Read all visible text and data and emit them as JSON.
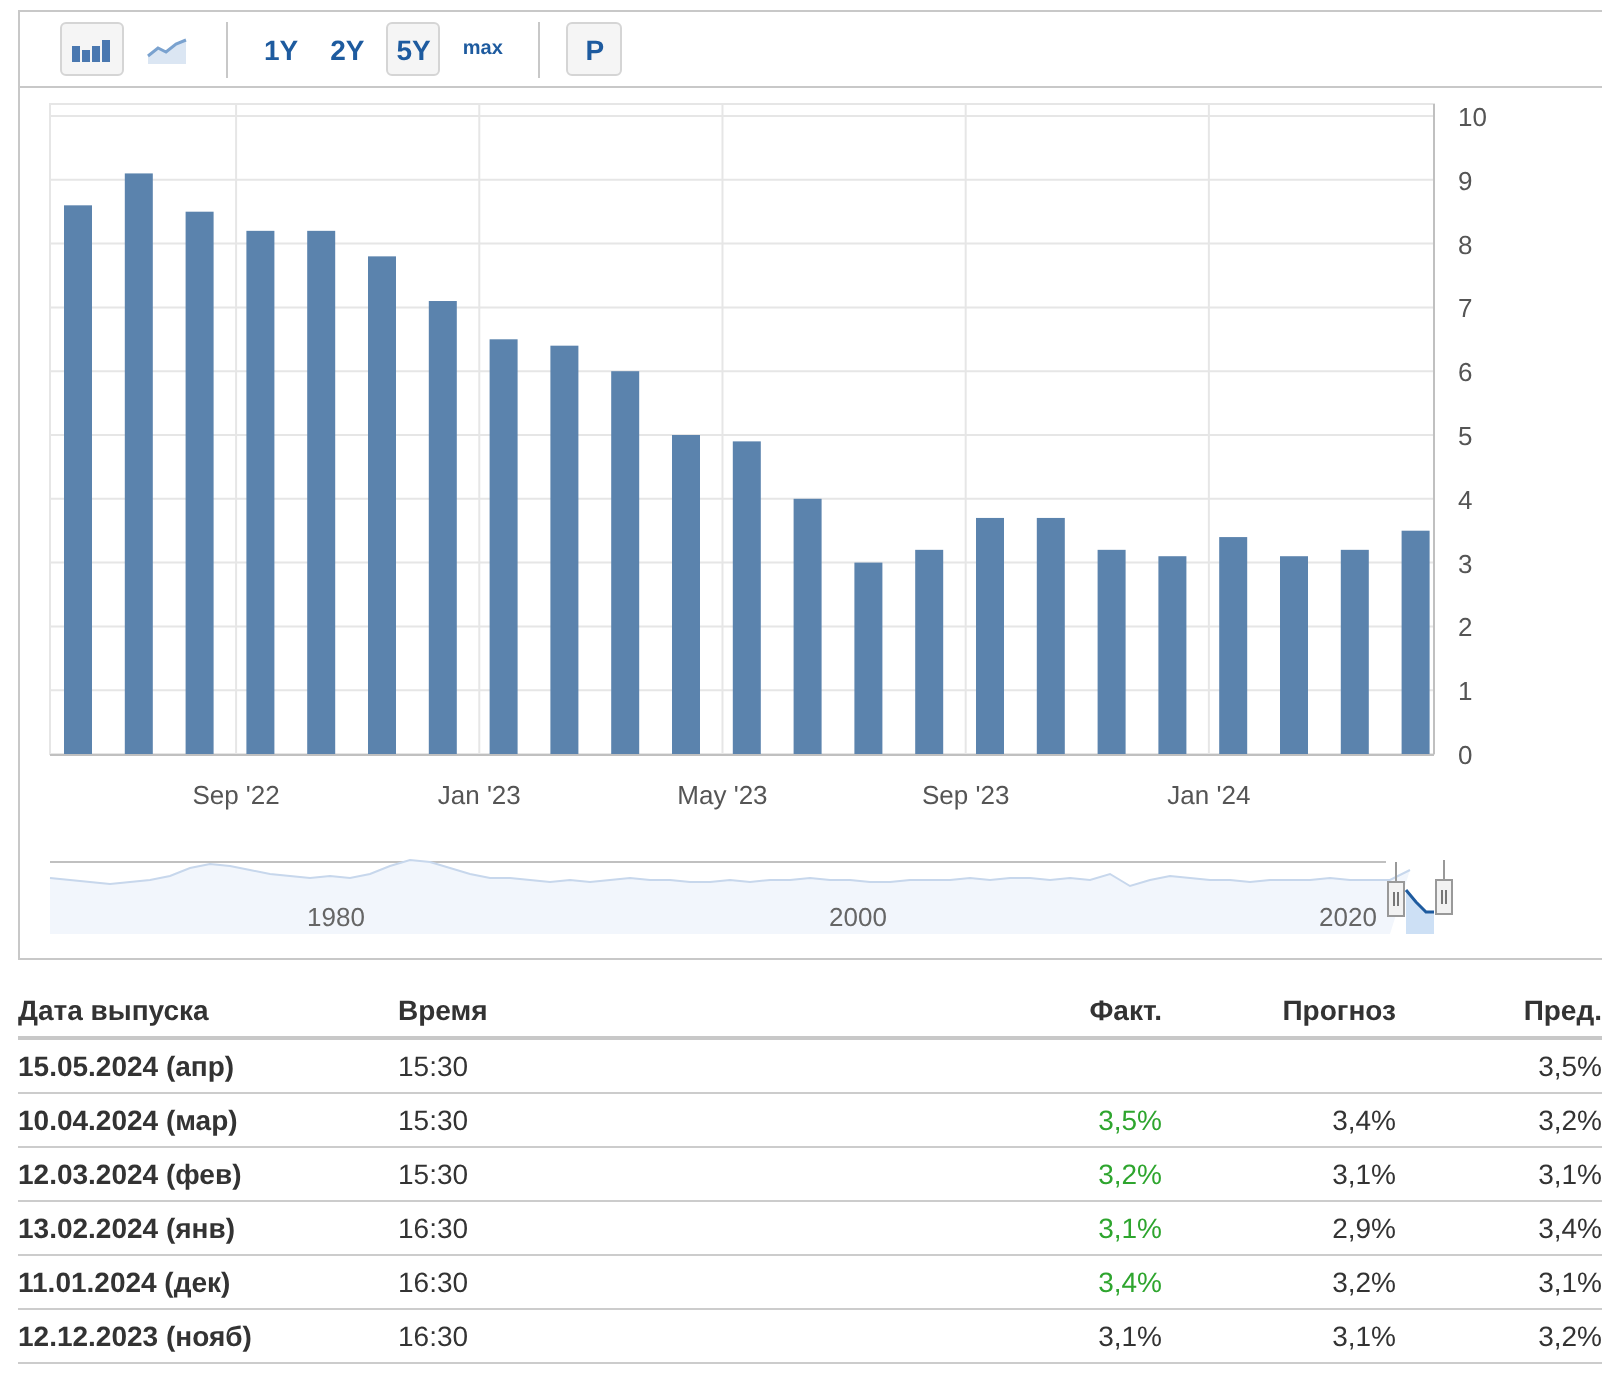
{
  "toolbar": {
    "chart_types": [
      {
        "kind": "bar",
        "selected": true
      },
      {
        "kind": "area",
        "selected": false
      }
    ],
    "ranges": [
      {
        "label": "1Y",
        "selected": false
      },
      {
        "label": "2Y",
        "selected": false
      },
      {
        "label": "5Y",
        "selected": true
      },
      {
        "label": "max",
        "selected": false
      }
    ],
    "extra_button": {
      "label": "P"
    }
  },
  "chart": {
    "chart_data": {
      "type": "bar",
      "categories": [
        null,
        null,
        null,
        "Sep '22",
        null,
        null,
        null,
        "Jan '23",
        null,
        null,
        null,
        "May '23",
        null,
        null,
        null,
        "Sep '23",
        null,
        null,
        null,
        "Jan '24",
        null,
        null,
        null
      ],
      "grid": true,
      "series": [
        {
          "color": "#5b83ad",
          "values": [
            8.6,
            9.1,
            8.5,
            8.2,
            8.2,
            7.8,
            7.1,
            6.5,
            6.4,
            6.0,
            5.0,
            4.9,
            4.0,
            3.0,
            3.2,
            3.7,
            3.7,
            3.2,
            3.1,
            3.4,
            3.1,
            3.2,
            3.5
          ]
        }
      ],
      "ylim": [
        0,
        10
      ],
      "yticks": [
        0,
        1,
        2,
        3,
        4,
        5,
        6,
        7,
        8,
        9,
        10
      ]
    },
    "navigator": {
      "labels": [
        "1980",
        "2000",
        "2020"
      ]
    }
  },
  "table": {
    "columns": [
      "Дата выпуска",
      "Время",
      "Факт.",
      "Прогноз",
      "Пред."
    ],
    "rows": [
      {
        "date": "15.05.2024 (апр)",
        "time": "15:30",
        "previous": "3,5%"
      },
      {
        "date": "10.04.2024 (мар)",
        "time": "15:30",
        "actual": "3,5%",
        "forecast": "3,4%",
        "previous": "3,2%",
        "color": "#2ea52e"
      },
      {
        "date": "12.03.2024 (фев)",
        "time": "15:30",
        "actual": "3,2%",
        "forecast": "3,1%",
        "previous": "3,1%",
        "color": "#2ea52e"
      },
      {
        "date": "13.02.2024 (янв)",
        "time": "16:30",
        "actual": "3,1%",
        "forecast": "2,9%",
        "previous": "3,4%",
        "color": "#2ea52e"
      },
      {
        "date": "11.01.2024 (дек)",
        "time": "16:30",
        "actual": "3,4%",
        "forecast": "3,2%",
        "previous": "3,1%",
        "color": "#2ea52e"
      },
      {
        "date": "12.12.2023 (нояб)",
        "time": "16:30",
        "actual": "3,1%",
        "forecast": "3,1%",
        "previous": "3,2%",
        "color": "#333333"
      }
    ]
  }
}
